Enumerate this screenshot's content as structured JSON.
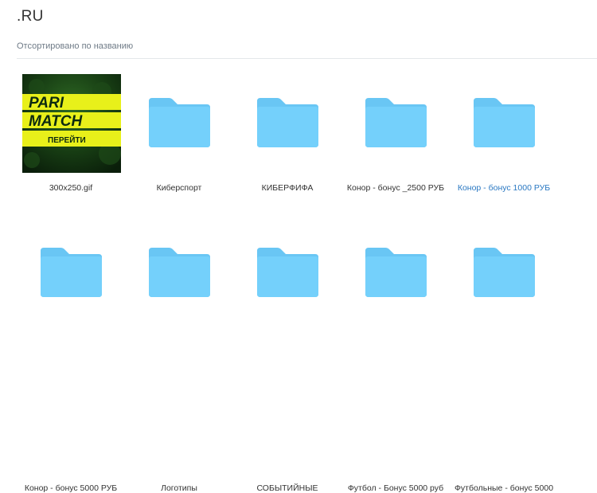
{
  "header": {
    "title": ".RU",
    "sort_label": "Отсортировано по названию"
  },
  "colors": {
    "folder_back": "#69c6f4",
    "folder_front": "#74d0fb",
    "active_link": "#2a78c2",
    "brand_yellow": "#e8f01a",
    "brand_green_dark": "#0c2a10"
  },
  "items": [
    {
      "label": "300x250.gif",
      "type": "gif",
      "active": false
    },
    {
      "label": "Киберспорт",
      "type": "folder",
      "icon": "folder-icon",
      "active": false
    },
    {
      "label": "КИБЕРФИФА",
      "type": "folder",
      "icon": "folder-icon",
      "active": false
    },
    {
      "label": "Конор - бонус _2500 РУБ",
      "type": "folder",
      "icon": "folder-icon",
      "active": false
    },
    {
      "label": "Конор - бонус 1000 РУБ",
      "type": "folder",
      "icon": "folder-icon",
      "active": true
    },
    {
      "label": "Конор - бонус 5000 РУБ",
      "type": "folder",
      "icon": "folder-icon",
      "active": false
    },
    {
      "label": "Логотипы",
      "type": "folder",
      "icon": "folder-icon",
      "active": false
    },
    {
      "label": "СОБЫТИЙНЫЕ",
      "type": "folder",
      "icon": "folder-icon",
      "active": false
    },
    {
      "label": "Футбол - Бонус 5000 руб",
      "type": "folder",
      "icon": "folder-icon",
      "active": false
    },
    {
      "label": "Футбольные - бонус 5000",
      "type": "folder",
      "icon": "folder-icon",
      "active": false
    }
  ],
  "banner": {
    "brand_line1": "PARI",
    "brand_line2": "MATCH",
    "cta": "ПЕРЕЙТИ"
  }
}
